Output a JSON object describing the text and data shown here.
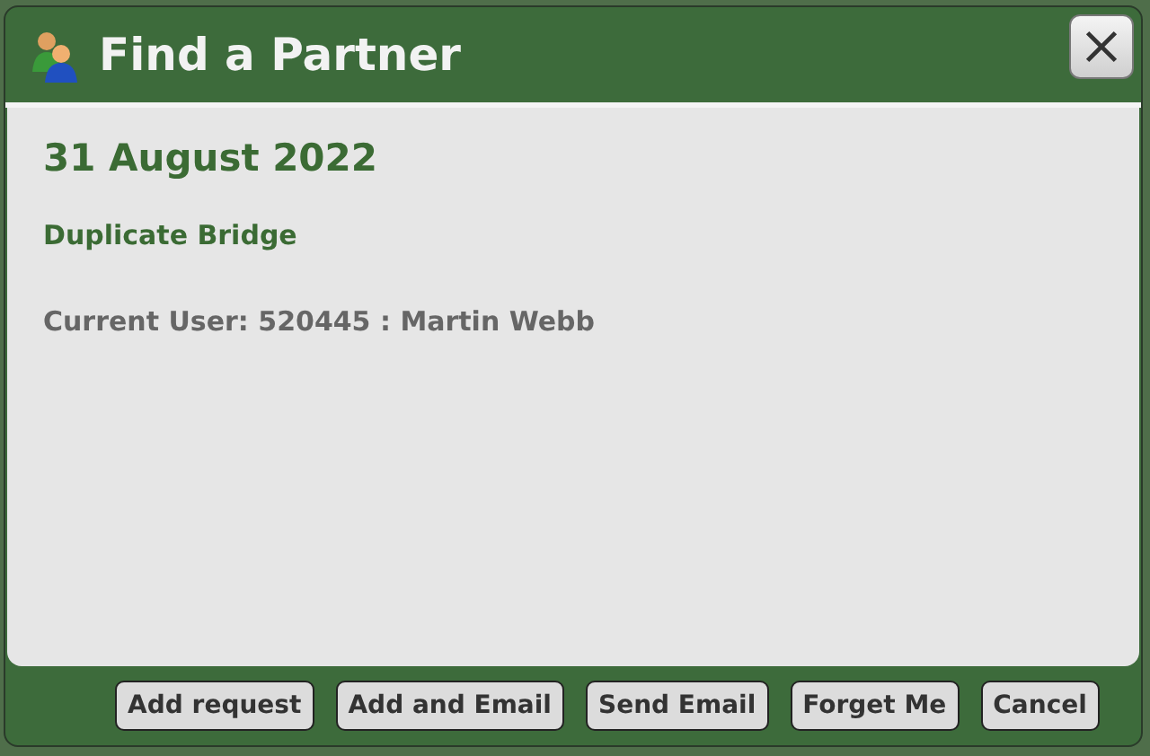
{
  "window": {
    "title": "Find a Partner"
  },
  "date": "31 August 2022",
  "event": "Duplicate Bridge",
  "current_user": "Current User: 520445 : Martin Webb",
  "buttons": [
    "Add request",
    "Add and Email",
    "Send Email",
    "Forget Me",
    "Cancel"
  ]
}
